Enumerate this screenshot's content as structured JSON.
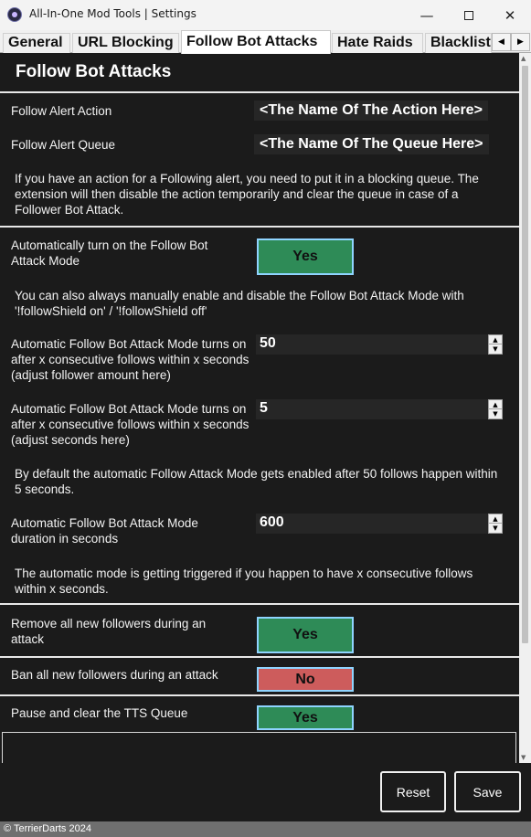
{
  "window": {
    "title": "All-In-One Mod Tools | Settings",
    "minimize": "—",
    "close": "✕"
  },
  "tabs": [
    {
      "label": "General",
      "active": false
    },
    {
      "label": "URL Blocking",
      "active": false
    },
    {
      "label": "Follow Bot Attacks",
      "active": true
    },
    {
      "label": "Hate Raids",
      "active": false
    },
    {
      "label": "Blacklist",
      "active": false
    }
  ],
  "tab_scroll": {
    "left": "◀",
    "right": "▶"
  },
  "page": {
    "title": "Follow Bot Attacks",
    "alert_action_label": "Follow Alert Action",
    "alert_action_value": "<The Name Of The Action Here>",
    "alert_queue_label": "Follow Alert Queue",
    "alert_queue_value": "<The Name Of The Queue Here>",
    "queue_info": "If you have an action for a Following alert, you need to put it in a blocking queue. The extension will then disable the action temporarily and clear the queue in case of a Follower Bot Attack.",
    "auto_mode_label": "Automatically turn on the Follow Bot Attack Mode",
    "auto_mode_value": "Yes",
    "manual_info": "You can also always manually enable and disable the Follow Bot Attack Mode with '!followShield on' / '!followShield off'",
    "follower_amount_label": "Automatic Follow Bot Attack Mode turns on after x consecutive follows within x seconds (adjust follower amount here)",
    "follower_amount_value": "50",
    "seconds_label": "Automatic Follow Bot Attack Mode turns on after x consecutive follows within x seconds (adjust seconds here)",
    "seconds_value": "5",
    "default_info": "By default the automatic Follow Attack Mode gets enabled after 50 follows happen within 5 seconds.",
    "duration_label": "Automatic Follow Bot Attack Mode duration in seconds",
    "duration_value": "600",
    "trigger_info": "The automatic mode is getting triggered if you happen to have x consecutive follows within x seconds.",
    "remove_label": "Remove all new followers during an attack",
    "remove_value": "Yes",
    "ban_label": "Ban all new followers during an attack",
    "ban_value": "No",
    "tts_label": "Pause and clear the TTS Queue",
    "tts_value": "Yes"
  },
  "buttons": {
    "reset": "Reset",
    "save": "Save"
  },
  "status": {
    "text": "© TerrierDarts 2024"
  },
  "colors": {
    "yes": "#2e8b57",
    "no": "#cd5c5c",
    "toggle_border": "#8fd4ff",
    "background": "#1b1b1b"
  }
}
